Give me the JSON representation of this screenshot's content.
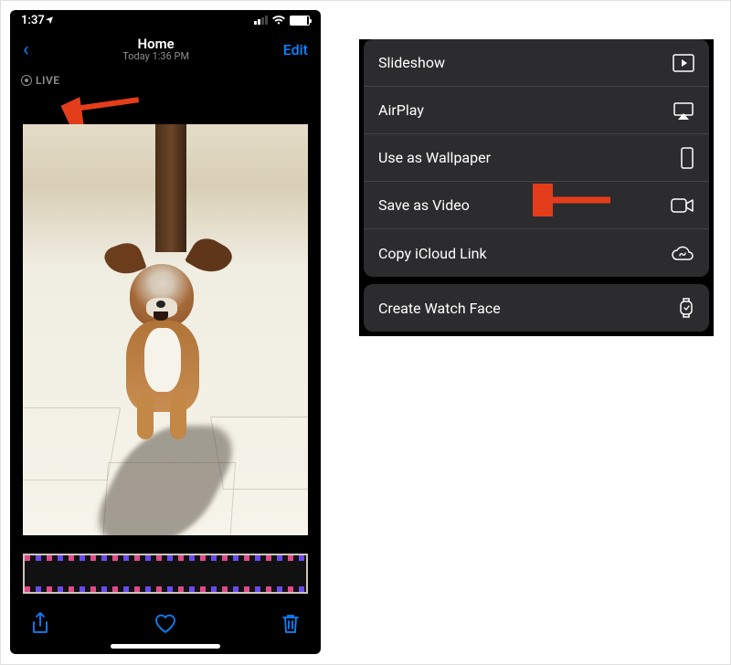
{
  "status": {
    "time": "1:37",
    "loc_arrow": "➔"
  },
  "nav": {
    "back": "‹",
    "title": "Home",
    "subtitle": "Today 1:36 PM",
    "edit": "Edit"
  },
  "live": {
    "label": "LIVE"
  },
  "toolbar": {
    "share": "share-icon",
    "heart": "heart-icon",
    "trash": "trash-icon"
  },
  "menu": {
    "group1": [
      {
        "label": "Slideshow",
        "icon": "slideshow-icon"
      },
      {
        "label": "AirPlay",
        "icon": "airplay-icon"
      },
      {
        "label": "Use as Wallpaper",
        "icon": "wallpaper-icon"
      },
      {
        "label": "Save as Video",
        "icon": "video-icon"
      },
      {
        "label": "Copy iCloud Link",
        "icon": "icloud-icon"
      }
    ],
    "group2": [
      {
        "label": "Create Watch Face",
        "icon": "watch-icon"
      }
    ]
  },
  "colors": {
    "accent": "#0a84ff",
    "arrow": "#e43d1c"
  }
}
